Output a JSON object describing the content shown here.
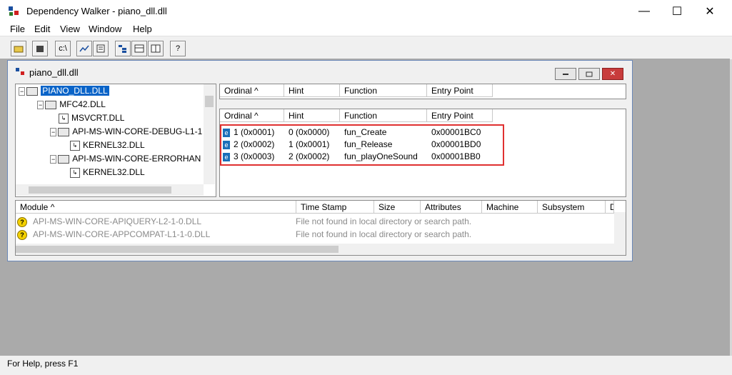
{
  "window": {
    "title": "Dependency Walker - piano_dll.dll",
    "min": "—",
    "max": "☐",
    "close": "✕"
  },
  "menu": [
    "File",
    "Edit",
    "View",
    "Window",
    "Help"
  ],
  "toolbar": {
    "buttons": [
      "open-icon",
      "save-icon",
      "cmd-icon",
      "profile-icon",
      "properties-icon",
      "tree-icon",
      "list-icon",
      "columns-icon",
      "help-icon"
    ],
    "labels": [
      "",
      "",
      "c:\\",
      "",
      "",
      "",
      "",
      "",
      "?"
    ]
  },
  "child": {
    "title": "piano_dll.dll"
  },
  "tree": [
    {
      "label": "PIANO_DLL.DLL",
      "selected": true
    },
    {
      "label": "MFC42.DLL"
    },
    {
      "label": "MSVCRT.DLL"
    },
    {
      "label": "API-MS-WIN-CORE-DEBUG-L1-1"
    },
    {
      "label": "KERNEL32.DLL"
    },
    {
      "label": "API-MS-WIN-CORE-ERRORHAN"
    },
    {
      "label": "KERNEL32.DLL"
    }
  ],
  "imports": {
    "headers": [
      "Ordinal ^",
      "Hint",
      "Function",
      "Entry Point"
    ]
  },
  "exports": {
    "headers": [
      "Ordinal ^",
      "Hint",
      "Function",
      "Entry Point"
    ],
    "rows": [
      {
        "icon": "e",
        "ordinal": "1  (0x0001)",
        "hint": "0  (0x0000)",
        "function": "fun_Create",
        "entry": "0x00001BC0"
      },
      {
        "icon": "e",
        "ordinal": "2  (0x0002)",
        "hint": "1  (0x0001)",
        "function": "fun_Release",
        "entry": "0x00001BD0"
      },
      {
        "icon": "e",
        "ordinal": "3  (0x0003)",
        "hint": "2  (0x0002)",
        "function": "fun_playOneSound",
        "entry": "0x00001BB0"
      }
    ]
  },
  "modules": {
    "headers": [
      "Module ^",
      "Time Stamp",
      "Size",
      "Attributes",
      "Machine",
      "Subsystem",
      "De"
    ],
    "rows": [
      {
        "icon": "?",
        "module": "API-MS-WIN-CORE-APIQUERY-L2-1-0.DLL",
        "time": "File not found in local directory or search path."
      },
      {
        "icon": "?",
        "module": "API-MS-WIN-CORE-APPCOMPAT-L1-1-0.DLL",
        "time": "File not found in local directory or search path."
      }
    ]
  },
  "status": {
    "text": "For Help, press F1"
  },
  "colors": {
    "highlight_box": "#e03030",
    "selection": "#0a64c8"
  }
}
